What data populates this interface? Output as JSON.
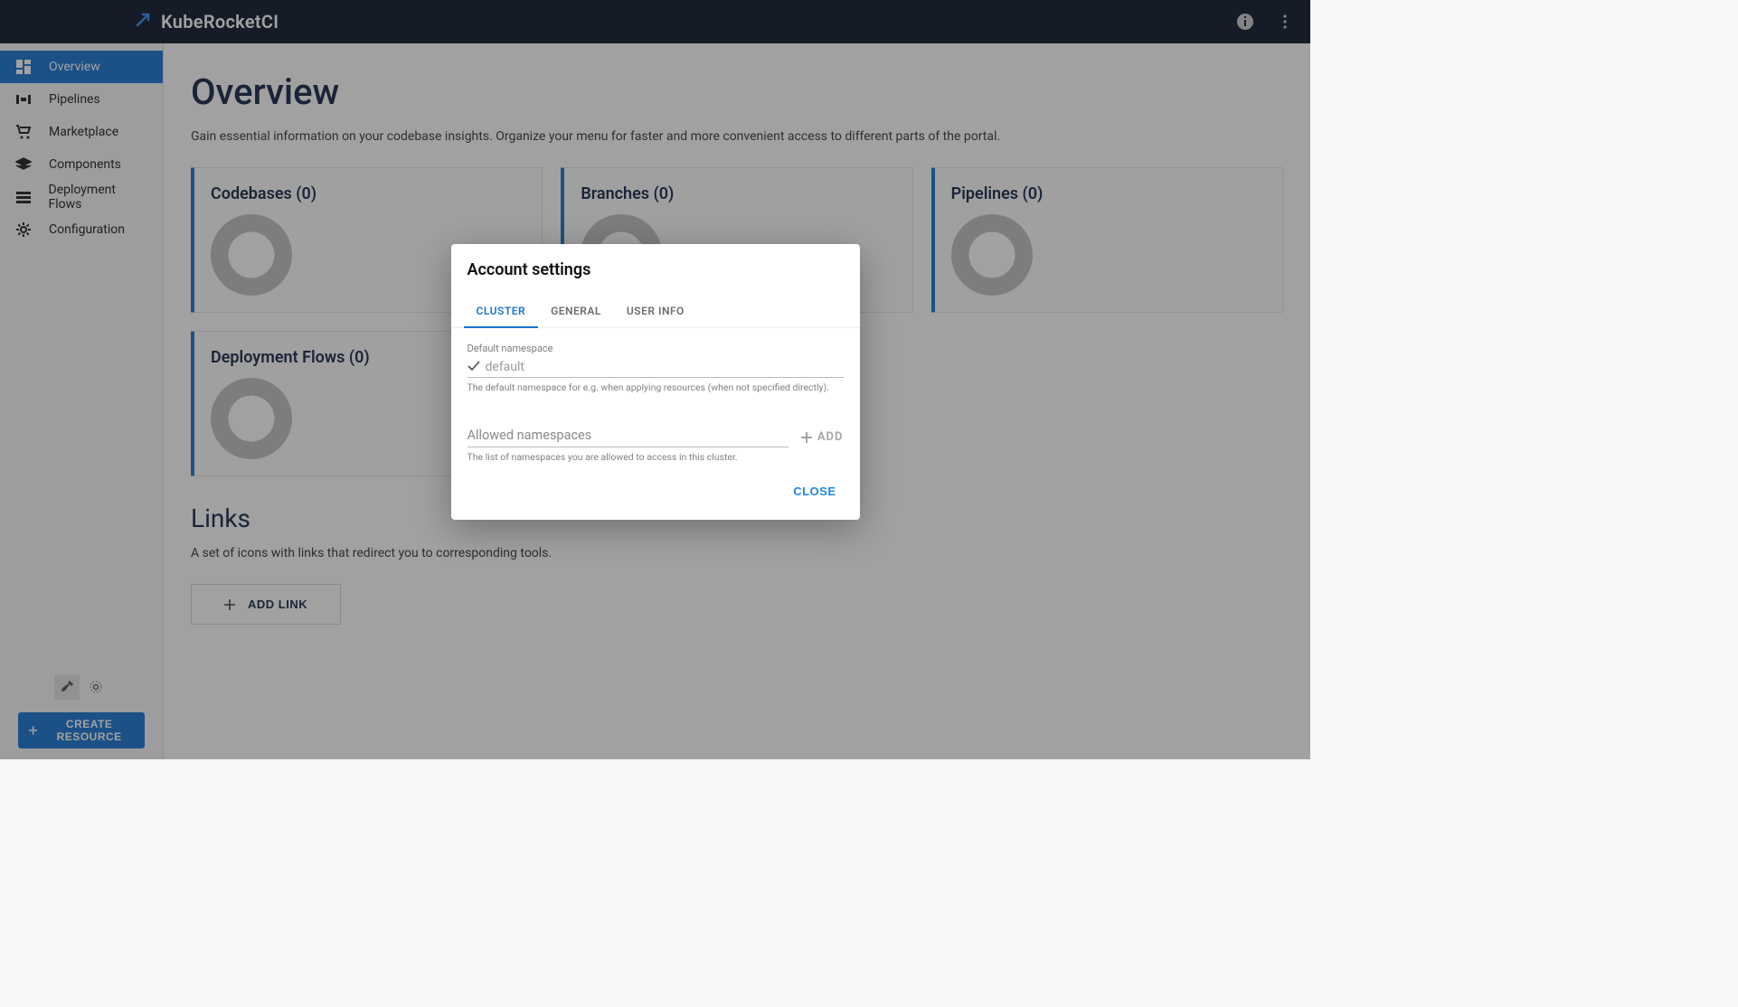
{
  "header": {
    "brand": "KubeRocketCI"
  },
  "sidebar": {
    "items": [
      {
        "label": "Overview"
      },
      {
        "label": "Pipelines"
      },
      {
        "label": "Marketplace"
      },
      {
        "label": "Components"
      },
      {
        "label": "Deployment Flows"
      },
      {
        "label": "Configuration"
      }
    ],
    "create_resource_label": "CREATE RESOURCE"
  },
  "page": {
    "title": "Overview",
    "subtitle": "Gain essential information on your codebase insights. Organize your menu for faster and more convenient access to different parts of the portal.",
    "cards": {
      "codebases": {
        "title": "Codebases (0)"
      },
      "branches": {
        "title": "Branches (0)"
      },
      "pipelines": {
        "title": "Pipelines (0)"
      },
      "flows": {
        "title": "Deployment Flows (0)"
      }
    },
    "links": {
      "title": "Links",
      "subtitle": "A set of icons with links that redirect you to corresponding tools.",
      "add_button": "ADD LINK"
    }
  },
  "modal": {
    "title": "Account settings",
    "tabs": {
      "cluster": "CLUSTER",
      "general": "GENERAL",
      "userinfo": "USER INFO"
    },
    "default_ns": {
      "label": "Default namespace",
      "placeholder": "default",
      "helper": "The default namespace for e.g. when applying resources (when not specified directly)."
    },
    "allowed_ns": {
      "label": "Allowed namespaces",
      "helper": "The list of namespaces you are allowed to access in this cluster.",
      "add_button": "ADD"
    },
    "close_label": "CLOSE"
  }
}
